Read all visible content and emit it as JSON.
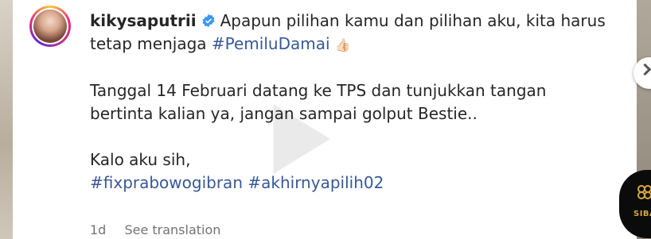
{
  "post": {
    "username": "kikysaputrii",
    "caption_line1": "Apapun pilihan kamu dan pilihan aku, kita harus",
    "caption_line2_prefix": "tetap menjaga ",
    "hashtag_pemilu": "#PemiluDamai",
    "emoji": "👍🏻",
    "para2_line1": "Tanggal 14 Februari datang ke TPS dan tunjukkan tangan",
    "para2_line2": "bertinta kalian ya, jangan sampai golput Bestie..",
    "para3_line1": "Kalo aku sih,",
    "hashtag_fix": "#fixprabowogibran",
    "hashtag_akhir": "#akhirnyapilih02",
    "time": "1d",
    "see_translation": "See translation"
  },
  "badge": {
    "text": "SIBA"
  },
  "colors": {
    "hashtag": "#385898",
    "verified": "#3897f0",
    "meta": "#737373",
    "badge_gold": "#d8a93a"
  }
}
